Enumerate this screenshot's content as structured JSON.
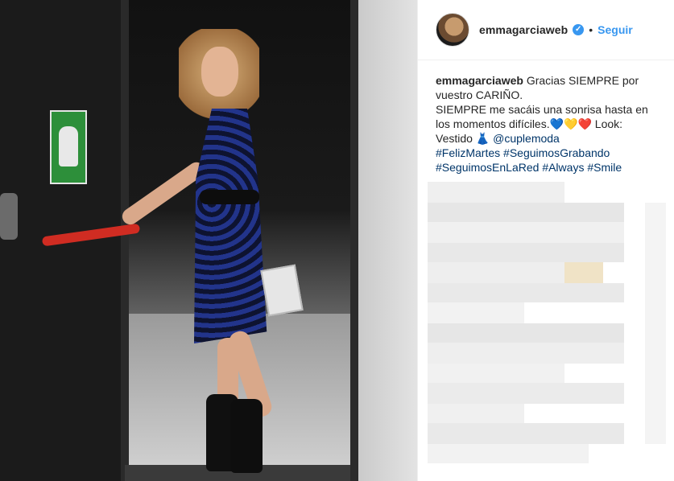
{
  "post": {
    "username": "emmagarciaweb",
    "verified_mark": "✓",
    "separator": "•",
    "follow_label": "Seguir"
  },
  "caption": {
    "username": "emmagarciaweb",
    "line1": " Gracias SIEMPRE por vuestro CARIÑO.",
    "line2": "SIEMPRE me sacáis una sonrisa hasta en los momentos difíciles.💙💛❤️ Look: Vestido 👗 ",
    "mention": "@cuplemoda",
    "hashtags": [
      "#FelizMartes",
      "#SeguimosGrabando",
      "#SeguimosEnLaRed",
      "#Always",
      "#Smile"
    ]
  },
  "colors": {
    "link_blue": "#3897f0",
    "text_dark": "#262626",
    "hashtag_blue": "#003569"
  }
}
